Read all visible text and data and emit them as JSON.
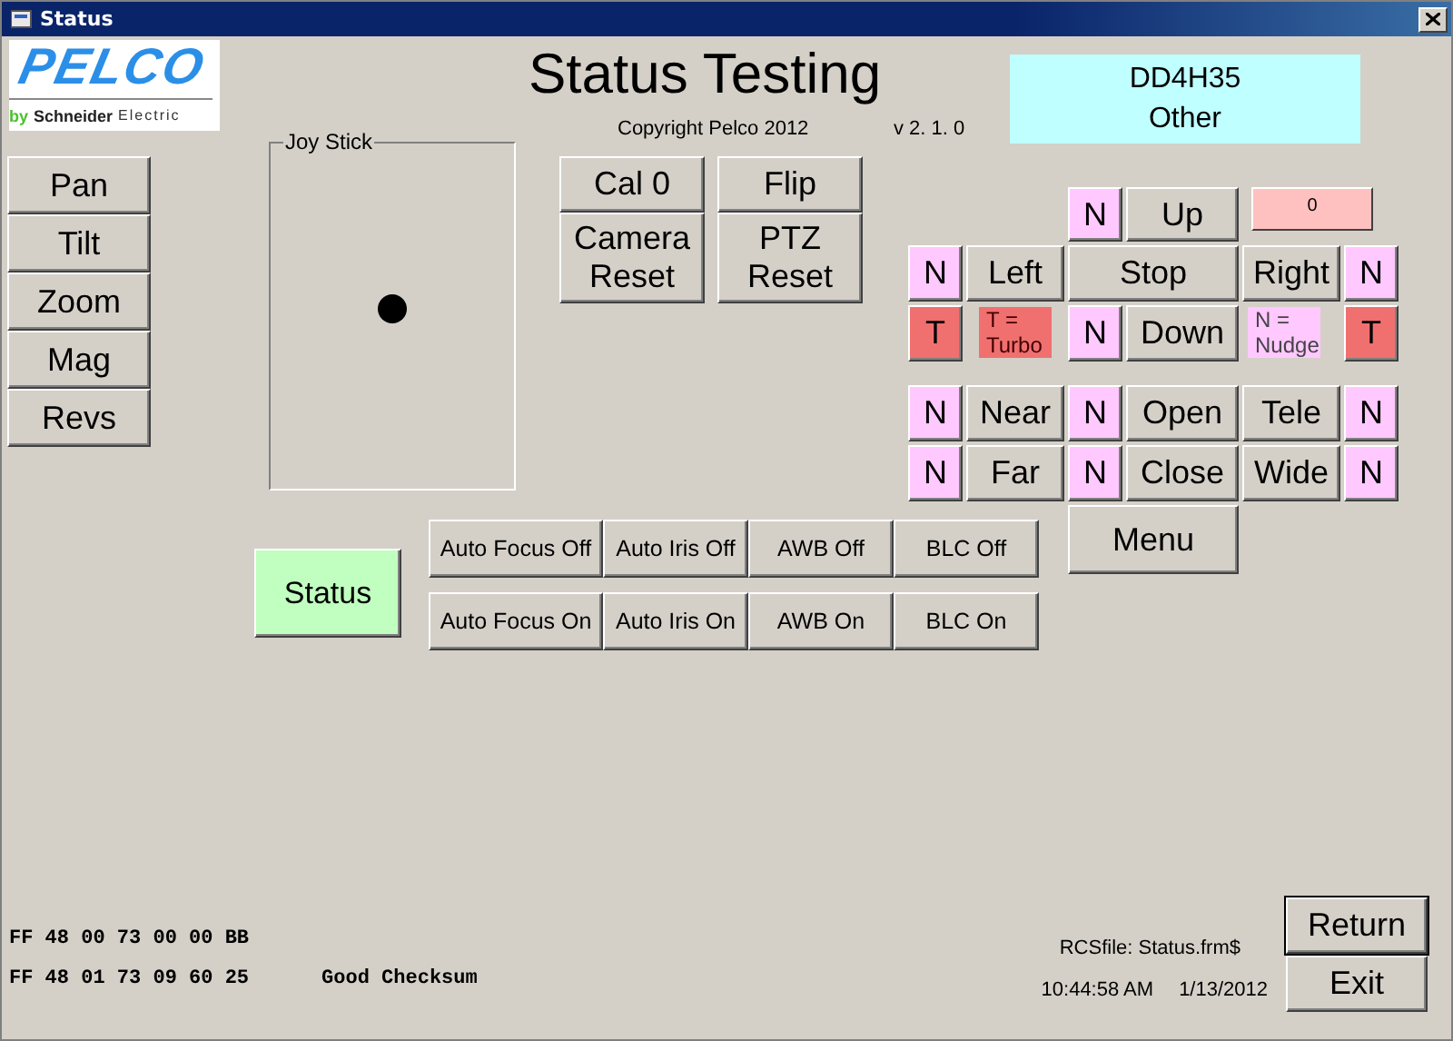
{
  "window": {
    "title": "Status"
  },
  "logo": {
    "brand": "PELCO",
    "tagline": [
      "by",
      "Schneider",
      "Electric"
    ]
  },
  "header": {
    "title": "Status Testing",
    "copyright": "Copyright Pelco 2012",
    "version": "v 2. 1. 0"
  },
  "model_box": {
    "lines": [
      "DD4H35",
      "Other"
    ]
  },
  "side_buttons": [
    "Pan",
    "Tilt",
    "Zoom",
    "Mag",
    "Revs"
  ],
  "joystick": {
    "label": "Joy Stick"
  },
  "setup_buttons": [
    "Cal 0",
    "Flip",
    "Camera Reset",
    "PTZ Reset"
  ],
  "ptz_pad": {
    "controls": [
      {
        "kind": "nudge",
        "label": "N"
      },
      {
        "kind": "button",
        "label": "Up"
      },
      {
        "kind": "counter",
        "label": "0"
      },
      {
        "kind": "nudge",
        "label": "N"
      },
      {
        "kind": "button",
        "label": "Left"
      },
      {
        "kind": "button",
        "label": "Stop"
      },
      {
        "kind": "button",
        "label": "Right"
      },
      {
        "kind": "nudge",
        "label": "N"
      },
      {
        "kind": "turbo",
        "label": "T"
      },
      {
        "kind": "turbo_legend",
        "label": "T = Turbo"
      },
      {
        "kind": "nudge",
        "label": "N"
      },
      {
        "kind": "button",
        "label": "Down"
      },
      {
        "kind": "nudge_legend",
        "label": "N = Nudge"
      },
      {
        "kind": "turbo",
        "label": "T"
      },
      {
        "kind": "nudge",
        "label": "N"
      },
      {
        "kind": "button",
        "label": "Near"
      },
      {
        "kind": "nudge",
        "label": "N"
      },
      {
        "kind": "button",
        "label": "Open"
      },
      {
        "kind": "button",
        "label": "Tele"
      },
      {
        "kind": "nudge",
        "label": "N"
      },
      {
        "kind": "nudge",
        "label": "N"
      },
      {
        "kind": "button",
        "label": "Far"
      },
      {
        "kind": "nudge",
        "label": "N"
      },
      {
        "kind": "button",
        "label": "Close"
      },
      {
        "kind": "button",
        "label": "Wide"
      },
      {
        "kind": "nudge",
        "label": "N"
      },
      {
        "kind": "button",
        "label": "Menu"
      }
    ]
  },
  "status_button": "Status",
  "camera_buttons": [
    [
      "Auto Focus Off",
      "Auto Iris Off",
      "AWB Off",
      "BLC Off"
    ],
    [
      "Auto Focus On",
      "Auto Iris On",
      "AWB On",
      "BLC On"
    ]
  ],
  "hex_lines": [
    {
      "text": "FF 48 00 73 00 00 BB"
    },
    {
      "text": "FF 48 01 73 09 60 25",
      "note": "Good Checksum"
    }
  ],
  "rcs_file": "RCSfile: Status.frm$",
  "time": "10:44:58 AM",
  "date": "1/13/2012",
  "bottom_buttons": [
    {
      "label": "Return",
      "default": true
    },
    {
      "label": "Exit",
      "default": false
    }
  ]
}
